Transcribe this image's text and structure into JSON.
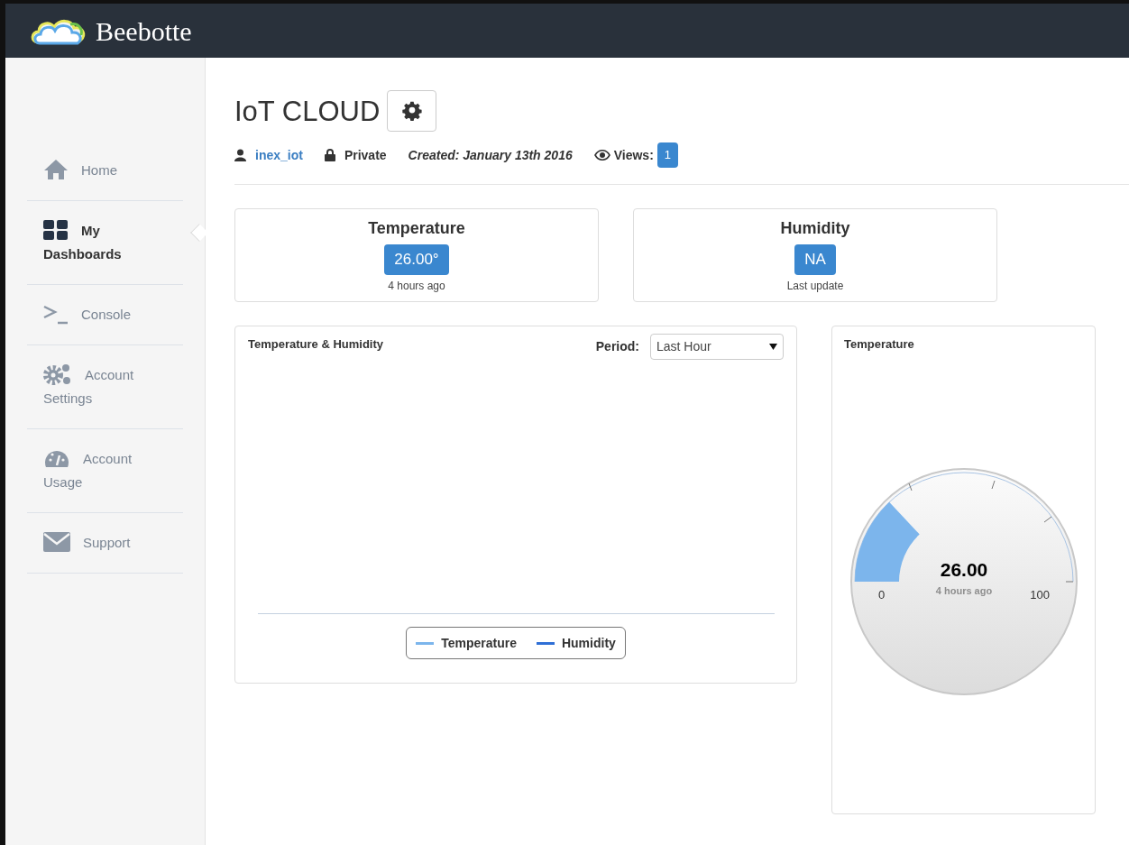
{
  "header": {
    "brand": "Beebotte"
  },
  "sidebar": {
    "items": [
      {
        "label": "Home",
        "selected": false
      },
      {
        "label": "My Dashboards",
        "selected": true
      },
      {
        "label": "Console",
        "selected": false
      },
      {
        "label": "Account Settings",
        "selected": false
      },
      {
        "label": "Account Usage",
        "selected": false
      },
      {
        "label": "Support",
        "selected": false
      }
    ]
  },
  "dashboard": {
    "title": "IoT CLOUD",
    "owner": "inex_iot",
    "visibility": "Private",
    "created": "Created: January 13th 2016",
    "views_label": "Views:",
    "views": "1"
  },
  "value_cards": [
    {
      "title": "Temperature",
      "value": "26.00°",
      "caption": "4 hours ago"
    },
    {
      "title": "Humidity",
      "value": "NA",
      "caption": "Last update"
    }
  ],
  "line_widget": {
    "title": "Temperature & Humidity",
    "period_label": "Period:",
    "period": "Last Hour",
    "legend": [
      {
        "label": "Temperature",
        "color": "#7cb5ec"
      },
      {
        "label": "Humidity",
        "color": "#2f6fd6"
      }
    ]
  },
  "gauge_widget": {
    "title": "Temperature",
    "value": "26.00",
    "caption": "4 hours ago",
    "min": "0",
    "max": "100"
  }
}
